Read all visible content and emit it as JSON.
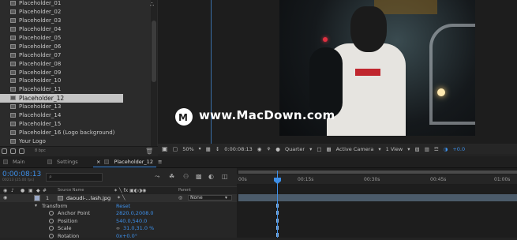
{
  "project_panel": {
    "items": [
      {
        "label": "Placeholder_01"
      },
      {
        "label": "Placeholder_02"
      },
      {
        "label": "Placeholder_03"
      },
      {
        "label": "Placeholder_04"
      },
      {
        "label": "Placeholder_05"
      },
      {
        "label": "Placeholder_06"
      },
      {
        "label": "Placeholder_07"
      },
      {
        "label": "Placeholder_08"
      },
      {
        "label": "Placeholder_09"
      },
      {
        "label": "Placeholder_10"
      },
      {
        "label": "Placeholder_11"
      },
      {
        "label": "Placeholder_12",
        "selected": true
      },
      {
        "label": "Placeholder_13"
      },
      {
        "label": "Placeholder_14"
      },
      {
        "label": "Placeholder_15"
      },
      {
        "label": "Placeholder_16 (Logo background)"
      },
      {
        "label": "Your Logo"
      }
    ],
    "footer_bpc": "8 bpc"
  },
  "viewer": {
    "watermark": "www.MacDown.com",
    "zoom": "50%",
    "timecode": "0:00:08:13",
    "resolution": "Quarter",
    "camera": "Active Camera",
    "view": "1 View",
    "exposure": "+0.0"
  },
  "tabs": [
    {
      "label": "Main"
    },
    {
      "label": "Settings"
    },
    {
      "label": "Placeholder_12",
      "active": true
    }
  ],
  "timeline": {
    "current_time": "0:00:08:13",
    "fps": "00213 (25.00 fps)",
    "columns": {
      "source_name": "Source Name",
      "parent": "Parent"
    },
    "layer": {
      "index": "1",
      "name": "daoudi-...lash.jpg",
      "parent": "None"
    },
    "transform_label": "Transform",
    "reset_label": "Reset",
    "properties": [
      {
        "label": "Anchor Point",
        "value": "2820.0,2008.0"
      },
      {
        "label": "Position",
        "value": "540.0,540.0"
      },
      {
        "label": "Scale",
        "value": "31.0,31.0 %"
      },
      {
        "label": "Rotation",
        "value": "0x+0.0°"
      }
    ],
    "ruler": [
      "00s",
      "00:15s",
      "00:30s",
      "00:45s",
      "01:00s"
    ]
  },
  "colors": {
    "accent_blue": "#3d8fe8"
  }
}
